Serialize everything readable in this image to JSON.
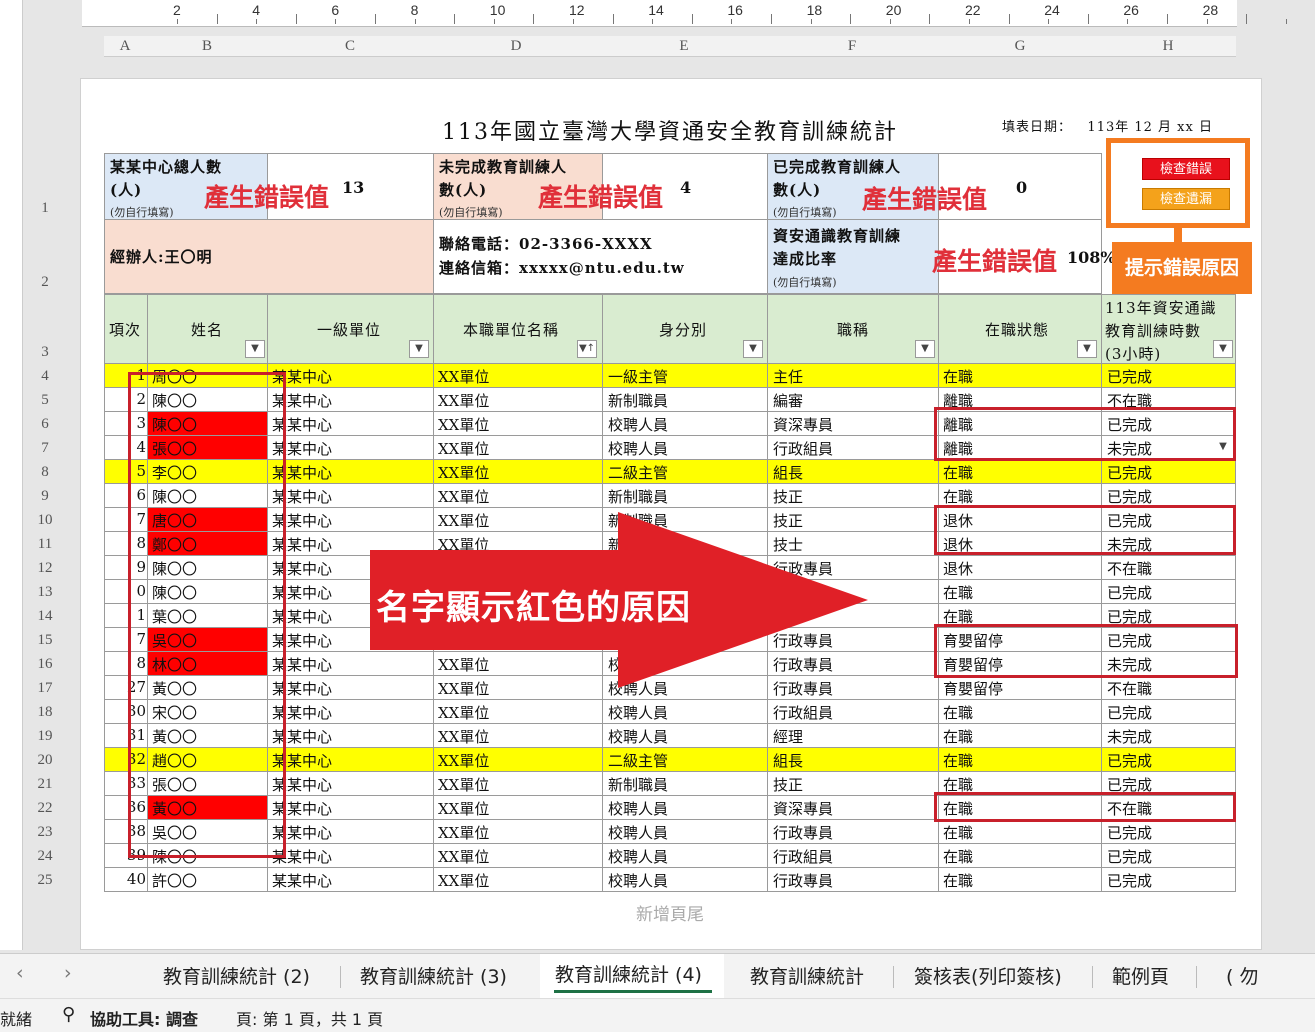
{
  "ruler": {
    "marks": [
      "2",
      "4",
      "6",
      "8",
      "10",
      "12",
      "14",
      "16",
      "18",
      "20",
      "22",
      "24",
      "26",
      "28"
    ]
  },
  "columns": [
    "A",
    "B",
    "C",
    "D",
    "E",
    "F",
    "G",
    "H"
  ],
  "sheet": {
    "title": "113年國立臺灣大學資通安全教育訓練統計",
    "date_label": "填表日期：",
    "date_value": "113年 12 月 xx 日",
    "summary": {
      "total_label_1": "某某中心總人數",
      "total_label_2": "(人)",
      "total_note": "(勿自行填寫)",
      "total_value": "13",
      "incomplete_label_1": "未完成教育訓練人",
      "incomplete_label_2": "數(人)",
      "incomplete_note": "(勿自行填寫)",
      "incomplete_value": "4",
      "complete_label_1": "已完成教育訓練人",
      "complete_label_2": "數(人)",
      "complete_note": "(勿自行填寫)",
      "complete_value": "0",
      "handler": "經辦人:王〇明",
      "phone": "聯絡電話：02-3366-XXXX",
      "email": "連絡信箱：xxxxx@ntu.edu.tw",
      "rate_label_1": "資安通識教育訓練",
      "rate_label_2": "達成比率",
      "rate_note": "(勿自行填寫)",
      "rate_value": "108%",
      "error_text": "產生錯誤值"
    },
    "buttons": {
      "check_error": "檢查錯誤",
      "check_missing": "檢查遺漏"
    },
    "hint_label": "提示錯誤原因",
    "headers": [
      "項次",
      "姓名",
      "一級單位",
      "本職單位名稱",
      "身分別",
      "職稱",
      "在職狀態"
    ],
    "header_h_1": "113年資安通識",
    "header_h_2": "教育訓練時數",
    "header_h_3": "(3小時)",
    "row_numbers": [
      "1",
      "2",
      "3",
      "4",
      "5",
      "6",
      "7",
      "8",
      "9",
      "10",
      "11",
      "12",
      "13",
      "14",
      "15",
      "16",
      "17",
      "18",
      "19",
      "20",
      "21",
      "22",
      "23",
      "24",
      "25"
    ],
    "rows": [
      {
        "no": "1",
        "name": "周〇〇",
        "unit": "某某中心",
        "dept": "XX單位",
        "role": "一級主管",
        "title": "主任",
        "status": "在職",
        "train": "已完成"
      },
      {
        "no": "2",
        "name": "陳〇〇",
        "unit": "某某中心",
        "dept": "XX單位",
        "role": "新制職員",
        "title": "編審",
        "status": "離職",
        "train": "不在職"
      },
      {
        "no": "3",
        "name": "陳〇〇",
        "unit": "某某中心",
        "dept": "XX單位",
        "role": "校聘人員",
        "title": "資深專員",
        "status": "離職",
        "train": "已完成"
      },
      {
        "no": "4",
        "name": "張〇〇",
        "unit": "某某中心",
        "dept": "XX單位",
        "role": "校聘人員",
        "title": "行政組員",
        "status": "離職",
        "train": "未完成"
      },
      {
        "no": "5",
        "name": "李〇〇",
        "unit": "某某中心",
        "dept": "XX單位",
        "role": "二級主管",
        "title": "組長",
        "status": "在職",
        "train": "已完成"
      },
      {
        "no": "6",
        "name": "陳〇〇",
        "unit": "某某中心",
        "dept": "XX單位",
        "role": "新制職員",
        "title": "技正",
        "status": "在職",
        "train": "已完成"
      },
      {
        "no": "7",
        "name": "唐〇〇",
        "unit": "某某中心",
        "dept": "XX單位",
        "role": "新制職員",
        "title": "技正",
        "status": "退休",
        "train": "已完成"
      },
      {
        "no": "8",
        "name": "鄭〇〇",
        "unit": "某某中心",
        "dept": "XX單位",
        "role": "新",
        "title": "技士",
        "status": "退休",
        "train": "未完成"
      },
      {
        "no": "9",
        "name": "陳〇〇",
        "unit": "某某中心",
        "dept": "",
        "role": "",
        "title": "行政專員",
        "status": "退休",
        "train": "不在職"
      },
      {
        "no": "0",
        "name": "陳〇〇",
        "unit": "某某中心",
        "dept": "",
        "role": "",
        "title": "",
        "status": "在職",
        "train": "已完成"
      },
      {
        "no": "1",
        "name": "葉〇〇",
        "unit": "某某中心",
        "dept": "",
        "role": "",
        "title": "",
        "status": "在職",
        "train": "已完成"
      },
      {
        "no": "7",
        "name": "吳〇〇",
        "unit": "某某中心",
        "dept": "",
        "role": "",
        "title": "行政專員",
        "status": "育嬰留停",
        "train": "已完成"
      },
      {
        "no": "8",
        "name": "林〇〇",
        "unit": "某某中心",
        "dept": "XX單位",
        "role": "校",
        "title": "行政專員",
        "status": "育嬰留停",
        "train": "未完成"
      },
      {
        "no": "27",
        "name": "黃〇〇",
        "unit": "某某中心",
        "dept": "XX單位",
        "role": "校聘人員",
        "title": "行政專員",
        "status": "育嬰留停",
        "train": "不在職"
      },
      {
        "no": "30",
        "name": "宋〇〇",
        "unit": "某某中心",
        "dept": "XX單位",
        "role": "校聘人員",
        "title": "行政組員",
        "status": "在職",
        "train": "已完成"
      },
      {
        "no": "31",
        "name": "黃〇〇",
        "unit": "某某中心",
        "dept": "XX單位",
        "role": "校聘人員",
        "title": "經理",
        "status": "在職",
        "train": "未完成"
      },
      {
        "no": "32",
        "name": "趙〇〇",
        "unit": "某某中心",
        "dept": "XX單位",
        "role": "二級主管",
        "title": "組長",
        "status": "在職",
        "train": "已完成"
      },
      {
        "no": "33",
        "name": "張〇〇",
        "unit": "某某中心",
        "dept": "XX單位",
        "role": "新制職員",
        "title": "技正",
        "status": "在職",
        "train": "已完成"
      },
      {
        "no": "36",
        "name": "黃〇〇",
        "unit": "某某中心",
        "dept": "XX單位",
        "role": "校聘人員",
        "title": "資深專員",
        "status": "在職",
        "train": "不在職"
      },
      {
        "no": "38",
        "name": "吳〇〇",
        "unit": "某某中心",
        "dept": "XX單位",
        "role": "校聘人員",
        "title": "行政專員",
        "status": "在職",
        "train": "已完成"
      },
      {
        "no": "39",
        "name": "陳〇〇",
        "unit": "某某中心",
        "dept": "XX單位",
        "role": "校聘人員",
        "title": "行政組員",
        "status": "在職",
        "train": "已完成"
      },
      {
        "no": "40",
        "name": "許〇〇",
        "unit": "某某中心",
        "dept": "XX單位",
        "role": "校聘人員",
        "title": "行政專員",
        "status": "在職",
        "train": "已完成"
      }
    ],
    "yellow_rows": [
      0,
      4,
      16
    ],
    "red_name_rows": [
      2,
      3,
      6,
      7,
      11,
      12,
      18
    ],
    "arrow_text": "名字顯示紅色的原因",
    "footer": "新增頁尾"
  },
  "tabs": {
    "items": [
      "教育訓練統計 (2)",
      "教育訓練統計 (3)",
      "教育訓練統計 (4)",
      "教育訓練統計",
      "簽核表(列印簽核)",
      "範例頁",
      "( 勿"
    ],
    "active_index": 2,
    "prev": "‹",
    "next": "›"
  },
  "status": {
    "ready": "就緒",
    "accessibility": "協助工具: 調查",
    "page": "頁: 第 1 頁，共 1 頁"
  },
  "colors": {
    "error_red": "#e0303a",
    "yellow": "#ffff00",
    "header_green": "#d9ecd0",
    "label_blue": "#dce8f6",
    "pink": "#f9ddd0",
    "orange": "#f47b20",
    "arrow_red": "#e02027"
  }
}
